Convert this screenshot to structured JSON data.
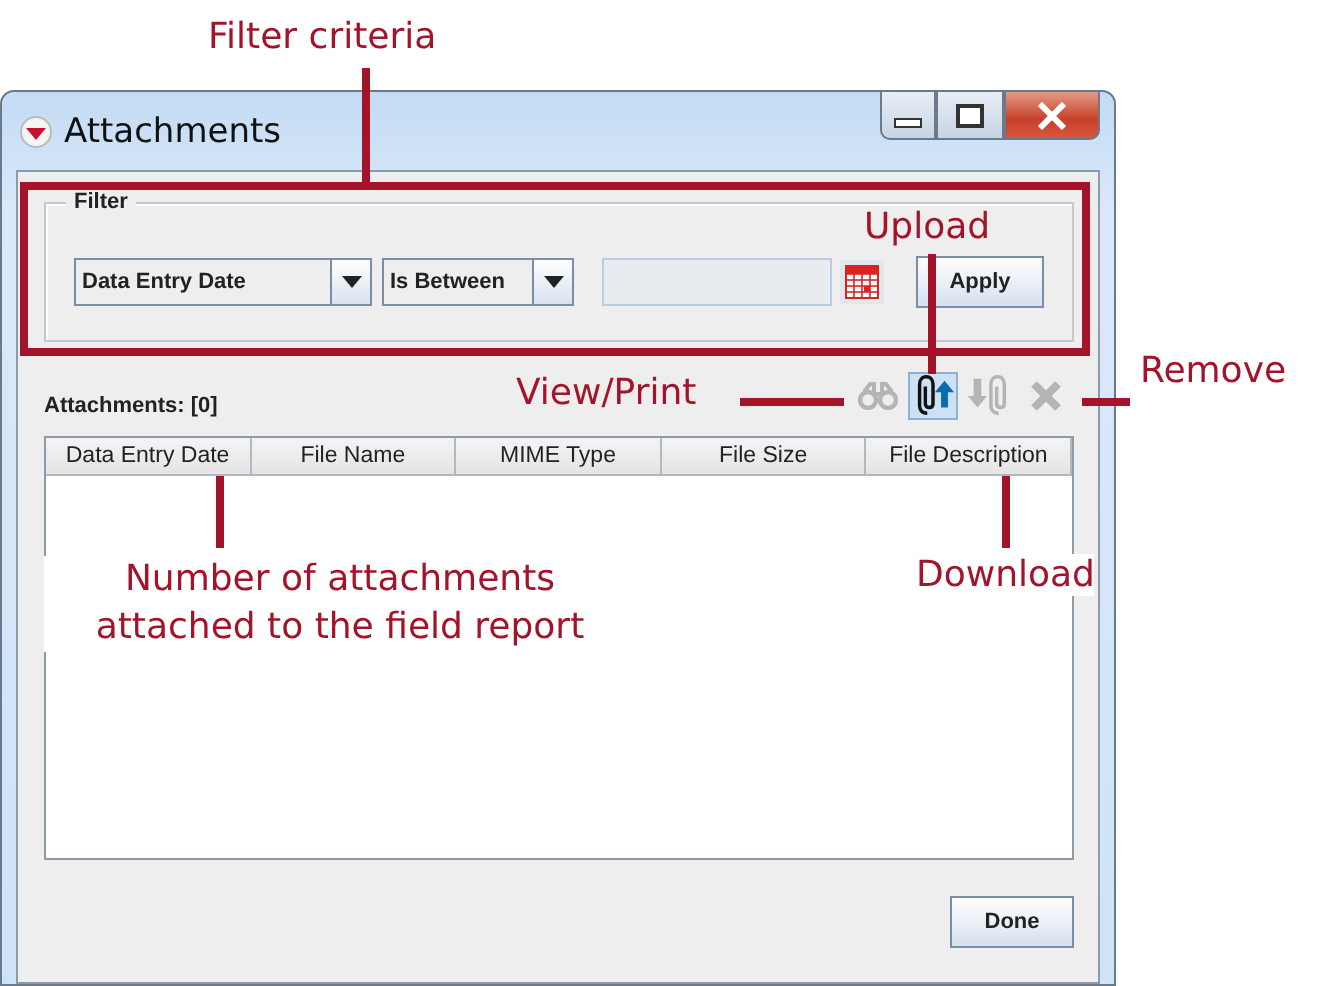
{
  "annotations": [
    {
      "text": "Filter criteria"
    },
    {
      "text": "Upload"
    },
    {
      "text": "View/Print"
    },
    {
      "text": "Remove"
    },
    {
      "text": "Number of attachments attached to the field report"
    },
    {
      "text": "Download"
    }
  ],
  "window": {
    "title": "Attachments"
  },
  "filter": {
    "legend": "Filter",
    "field": "Data Entry Date",
    "operator": "Is Between",
    "apply": "Apply"
  },
  "attachments_label": "Attachments: [0]",
  "toolbar": [
    {
      "kind": "view",
      "disabled": true,
      "selected": false
    },
    {
      "kind": "upload",
      "disabled": false,
      "selected": true
    },
    {
      "kind": "download",
      "disabled": true,
      "selected": false
    },
    {
      "kind": "remove",
      "disabled": true,
      "selected": false
    }
  ],
  "table": {
    "columns": [
      "Data Entry Date",
      "File Name",
      "MIME Type",
      "File Size",
      "File Description"
    ]
  },
  "done": "Done"
}
